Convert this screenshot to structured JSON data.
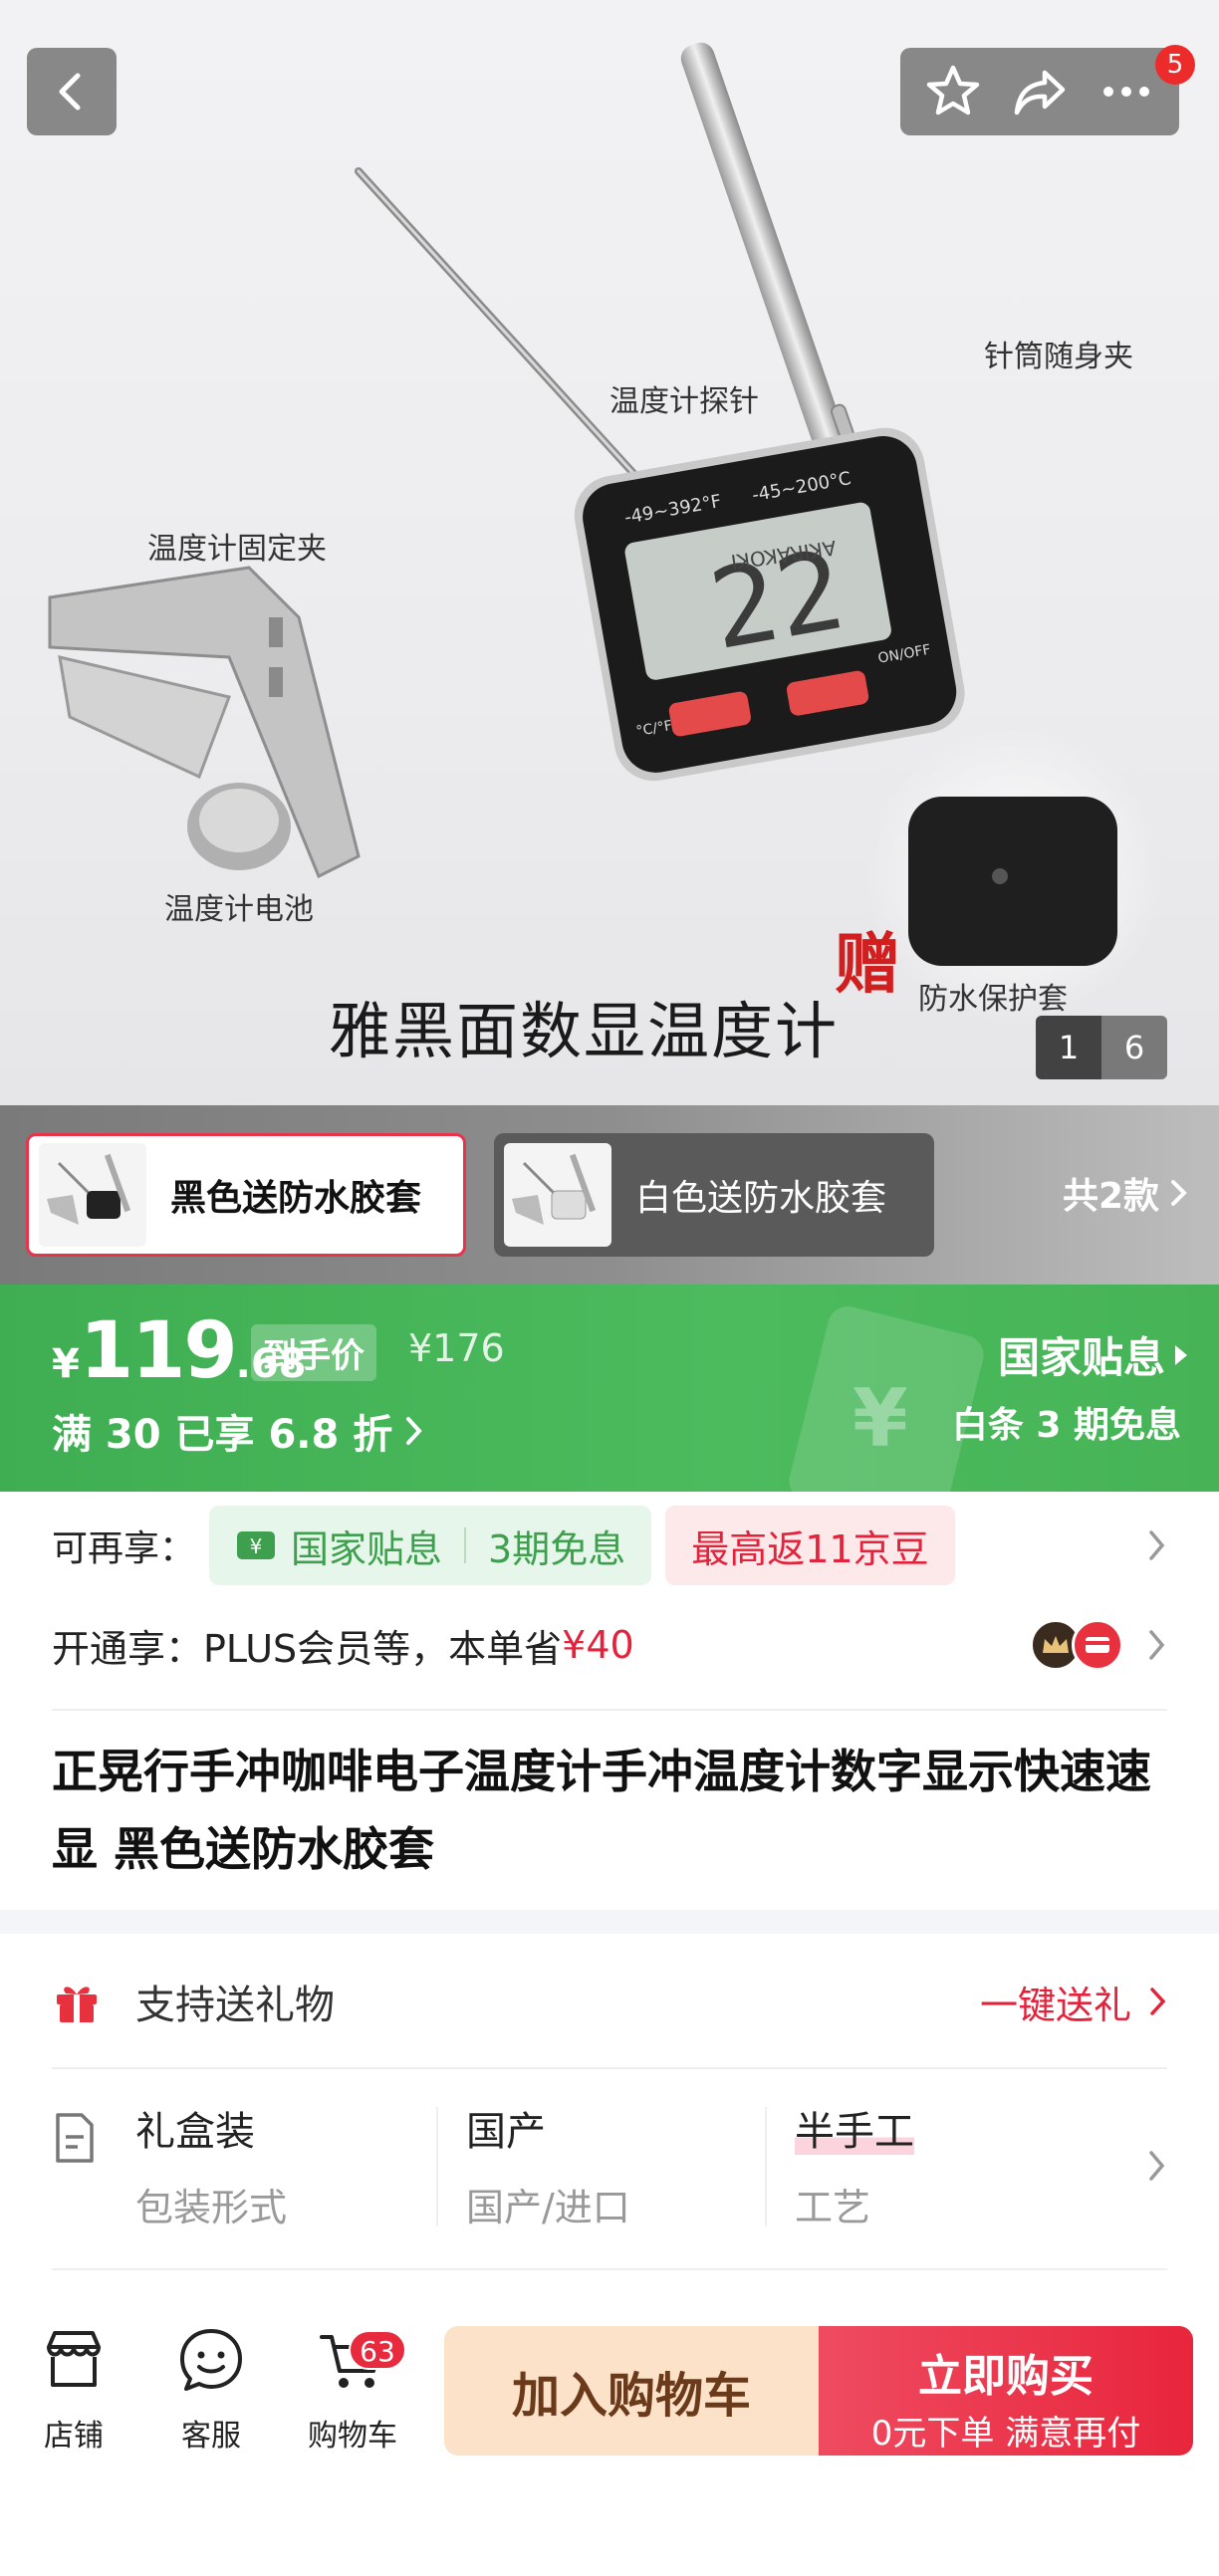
{
  "top_bar": {
    "message_count": "5"
  },
  "hero": {
    "labels": {
      "probe": "温度计探针",
      "sleeve": "针筒随身夹",
      "clip": "温度计固定夹",
      "battery": "温度计电池",
      "cover": "防水保护套"
    },
    "gift_char": "赠",
    "caption": "雅黑面数显温度计",
    "device_brand": "AKIRAKOKI",
    "device_range_f": "-49~392°F",
    "device_range_c": "-45~200°C",
    "device_reading": "22",
    "device_unit_btn": "°C/°F",
    "device_power_btn": "ON/OFF",
    "page_current": "1",
    "page_total": "6"
  },
  "variants": {
    "items": [
      {
        "label": "黑色送防水胶套",
        "selected": true
      },
      {
        "label": "白色送防水胶套",
        "selected": false
      }
    ],
    "count_label": "共2款"
  },
  "price": {
    "currency": "¥",
    "integer": "119",
    "decimal": ".68",
    "tag": "到手价",
    "original": "¥176",
    "discount": "满 30 已享 6.8 折",
    "subsidy_title": "国家贴息",
    "subsidy_sub": "白条 3 期免息"
  },
  "perks": {
    "label": "可再享：",
    "chip_green_a": "国家贴息",
    "chip_green_b": "3期免息",
    "chip_red": "最高返11京豆"
  },
  "plus": {
    "text": "开通享：PLUS会员等，本单省",
    "amount": "¥40"
  },
  "product": {
    "title": "正晃行手冲咖啡电子温度计手冲温度计数字显示快速速显 黑色送防水胶套"
  },
  "gift": {
    "label": "支持送礼物",
    "action": "一键送礼"
  },
  "specs": [
    {
      "value": "礼盒装",
      "key": "包装形式"
    },
    {
      "value": "国产",
      "key": "国产/进口"
    },
    {
      "value": "半手工",
      "key": "工艺"
    }
  ],
  "bottom": {
    "tab_store": "店铺",
    "tab_service": "客服",
    "tab_cart": "购物车",
    "cart_count": "63",
    "add_to_cart": "加入购物车",
    "buy_now": "立即购买",
    "buy_sub": "0元下单 满意再付"
  },
  "colors": {
    "accent_red": "#e2233b",
    "subsidy_green": "#45b356",
    "cart_button": "#fbe2c9"
  }
}
